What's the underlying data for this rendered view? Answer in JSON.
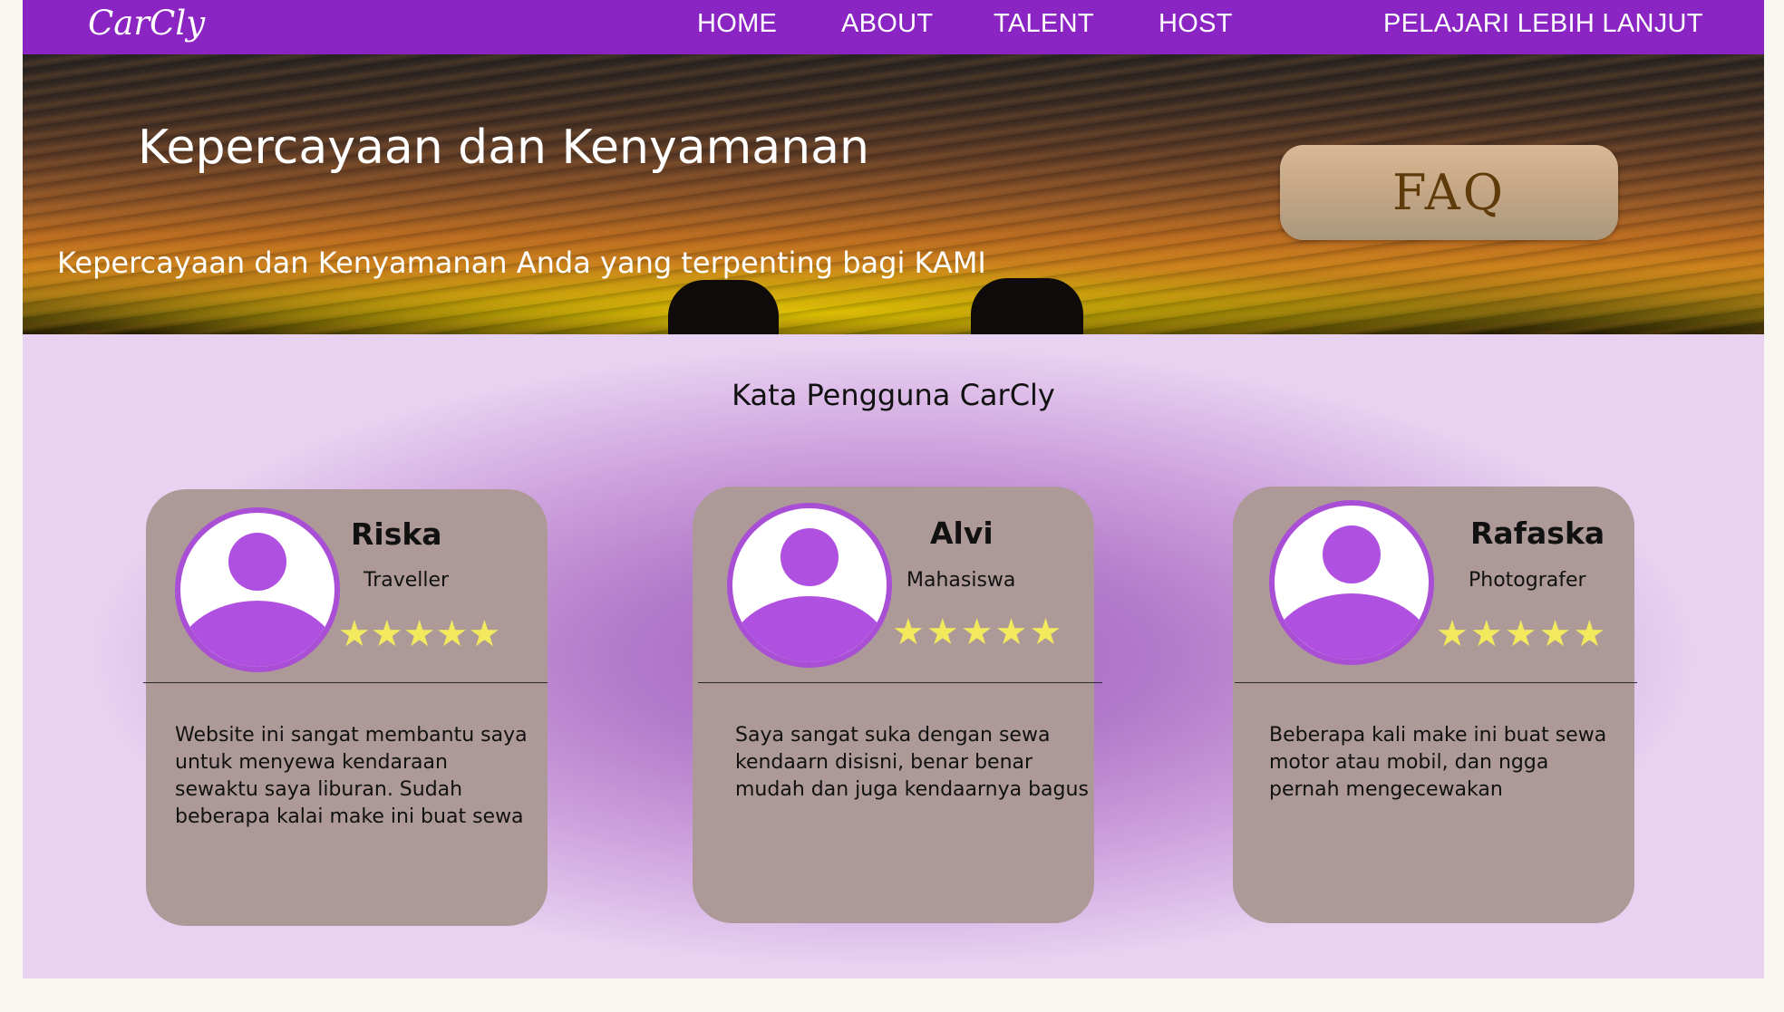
{
  "nav": {
    "brand": "CarCly",
    "links": [
      "HOME",
      "ABOUT",
      "TALENT",
      "HOST"
    ],
    "cta": "PELAJARI LEBIH LANJUT"
  },
  "hero": {
    "title": "Kepercayaan dan Kenyamanan",
    "subtitle": "Kepercayaan dan Kenyamanan Anda yang terpenting bagi KAMI",
    "faq_label": "FAQ"
  },
  "testimonials": {
    "heading": "Kata Pengguna CarCly",
    "cards": [
      {
        "name": "Riska",
        "role": "Traveller",
        "rating": 5,
        "quote": "Website ini sangat membantu saya untuk menyewa kendaraan sewaktu saya liburan. Sudah beberapa kalai make ini buat sewa"
      },
      {
        "name": "Alvi",
        "role": "Mahasiswa",
        "rating": 5,
        "quote": "Saya sangat suka dengan sewa kendaarn disisni, benar benar mudah dan juga kendaarnya bagus"
      },
      {
        "name": "Rafaska",
        "role": "Photografer",
        "rating": 5,
        "quote": "Beberapa kali make ini buat sewa motor atau mobil, dan ngga pernah mengecewakan"
      }
    ]
  },
  "colors": {
    "nav_bg": "#8a24c2",
    "card_bg": "#ad9a98",
    "avatar_accent": "#b050e0",
    "star": "#f2ea5c",
    "faq_text": "#5f3a0b"
  },
  "icons": {
    "avatar": "user-avatar-icon",
    "star": "star-icon"
  }
}
